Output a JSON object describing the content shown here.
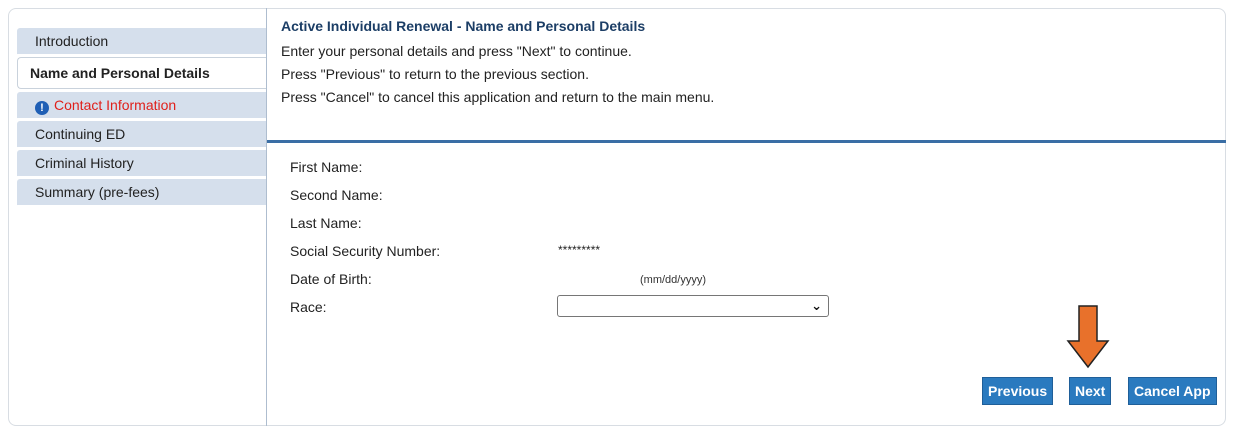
{
  "sidebar": {
    "items": [
      {
        "label": "Introduction"
      },
      {
        "label": "Name and Personal Details"
      },
      {
        "label": "Contact Information"
      },
      {
        "label": "Continuing ED"
      },
      {
        "label": "Criminal History"
      },
      {
        "label": "Summary (pre-fees)"
      }
    ]
  },
  "header": {
    "title": "Active Individual Renewal - Name and Personal Details",
    "instructions": [
      "Enter your personal details and press \"Next\" to continue.",
      "Press \"Previous\" to return to the previous section.",
      "Press \"Cancel\" to cancel this application and return to the main menu."
    ]
  },
  "form": {
    "first_name_label": "First Name:",
    "second_name_label": "Second Name:",
    "last_name_label": "Last Name:",
    "ssn_label": "Social Security Number:",
    "ssn_value": "*********",
    "dob_label": "Date of Birth:",
    "dob_hint": "(mm/dd/yyyy)",
    "race_label": "Race:",
    "race_selected": ""
  },
  "buttons": {
    "previous": "Previous",
    "next": "Next",
    "cancel": "Cancel App"
  },
  "colors": {
    "accent": "#2a7abf",
    "arrow": "#e8712b",
    "error": "#e0201b"
  }
}
